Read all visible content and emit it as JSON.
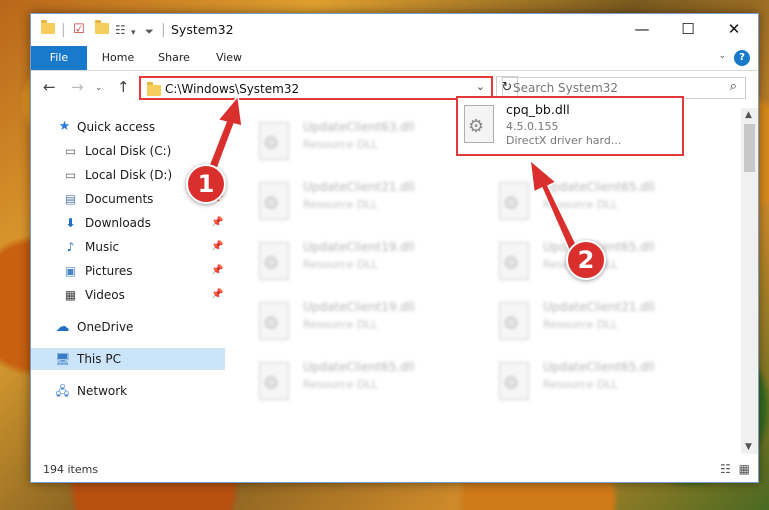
{
  "window": {
    "title": "System32",
    "minimize": "—",
    "maximize": "☐",
    "close": "✕"
  },
  "ribbon": {
    "tabs": [
      "File",
      "Home",
      "Share",
      "View"
    ],
    "help": "?"
  },
  "nav": {
    "back": "←",
    "forward": "→",
    "up": "↑",
    "address": "C:\\Windows\\System32",
    "refresh": "↻",
    "search_placeholder": "Search System32",
    "search_icon": "⌕"
  },
  "sidebar": {
    "items": [
      {
        "label": "Quick access",
        "icon": "star-icon",
        "pinned": false
      },
      {
        "label": "Local Disk (C:)",
        "icon": "drive-icon",
        "pinned": false
      },
      {
        "label": "Local Disk (D:)",
        "icon": "drive-icon",
        "pinned": false
      },
      {
        "label": "Documents",
        "icon": "documents-icon",
        "pinned": true
      },
      {
        "label": "Downloads",
        "icon": "download-icon",
        "pinned": true
      },
      {
        "label": "Music",
        "icon": "music-icon",
        "pinned": true
      },
      {
        "label": "Pictures",
        "icon": "pictures-icon",
        "pinned": true
      },
      {
        "label": "Videos",
        "icon": "videos-icon",
        "pinned": true
      },
      {
        "label": "OneDrive",
        "icon": "cloud-icon",
        "pinned": false
      },
      {
        "label": "This PC",
        "icon": "computer-icon",
        "pinned": false
      },
      {
        "label": "Network",
        "icon": "network-icon",
        "pinned": false
      }
    ]
  },
  "files": [
    {
      "name": "UpdateClient63.dll",
      "type": "Resource DLL"
    },
    {
      "name": "UpdateClient21.dll",
      "type": "Resource DLL"
    },
    {
      "name": "UpdateClient65.dll",
      "type": "Resource DLL"
    },
    {
      "name": "UpdateClient19.dll",
      "type": "Resource DLL"
    },
    {
      "name": "UpdateClient65.dll",
      "type": "Resource DLL"
    },
    {
      "name": "UpdateClient19.dll",
      "type": "Resource DLL"
    },
    {
      "name": "UpdateClient21.dll",
      "type": "Resource DLL"
    },
    {
      "name": "UpdateClient65.dll",
      "type": "Resource DLL"
    },
    {
      "name": "UpdateClient65.dll",
      "type": "Resource DLL"
    }
  ],
  "highlighted_file": {
    "name": "cpq_bb.dll",
    "version": "4.5.0.155",
    "description": "DirectX driver hard..."
  },
  "status": {
    "item_count": "194 items"
  },
  "annotations": {
    "step1": "1",
    "step2": "2",
    "color": "#d9302e"
  }
}
